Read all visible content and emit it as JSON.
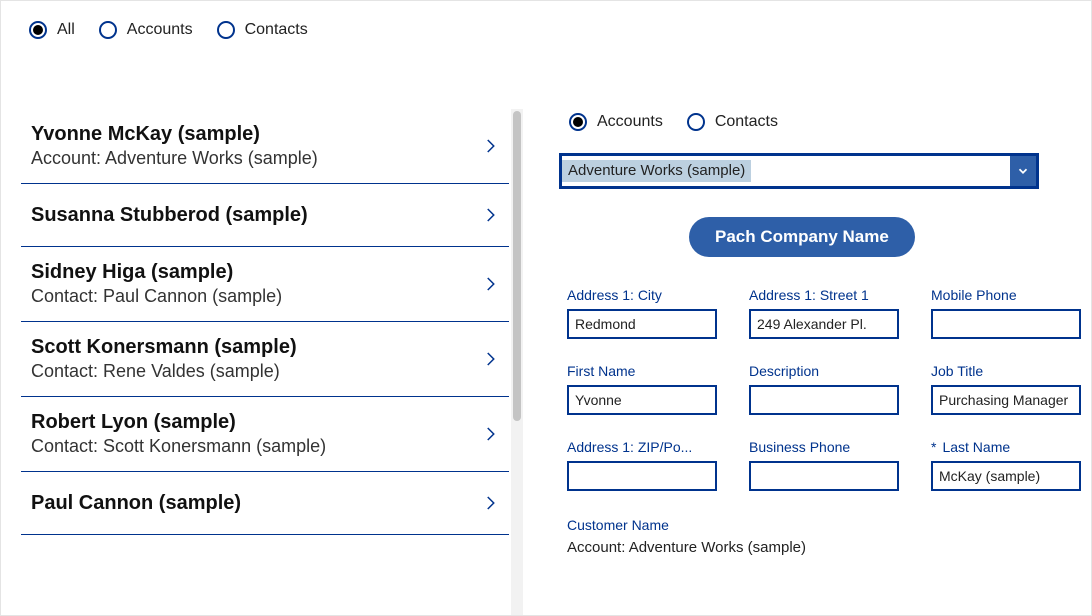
{
  "topFilters": [
    {
      "label": "All",
      "selected": true
    },
    {
      "label": "Accounts",
      "selected": false
    },
    {
      "label": "Contacts",
      "selected": false
    }
  ],
  "list": [
    {
      "title": "Yvonne McKay (sample)",
      "subtitle": "Account: Adventure Works (sample)"
    },
    {
      "title": "Susanna Stubberod (sample)",
      "subtitle": ""
    },
    {
      "title": "Sidney Higa (sample)",
      "subtitle": "Contact: Paul Cannon (sample)"
    },
    {
      "title": "Scott Konersmann (sample)",
      "subtitle": "Contact: Rene Valdes (sample)"
    },
    {
      "title": "Robert Lyon (sample)",
      "subtitle": "Contact: Scott Konersmann (sample)"
    },
    {
      "title": "Paul Cannon (sample)",
      "subtitle": ""
    }
  ],
  "detailFilters": [
    {
      "label": "Accounts",
      "selected": true
    },
    {
      "label": "Contacts",
      "selected": false
    }
  ],
  "accountSelect": "Adventure Works (sample)",
  "primaryButton": "Pach Company Name",
  "fields": [
    {
      "label": "Address 1: City",
      "value": "Redmond",
      "required": false
    },
    {
      "label": "Address 1: Street 1",
      "value": "249 Alexander Pl.",
      "required": false
    },
    {
      "label": "Mobile Phone",
      "value": "",
      "required": false
    },
    {
      "label": "First Name",
      "value": "Yvonne",
      "required": false
    },
    {
      "label": "Description",
      "value": "",
      "required": false
    },
    {
      "label": "Job Title",
      "value": "Purchasing Manager",
      "required": false
    },
    {
      "label": "Address 1: ZIP/Po...",
      "value": "",
      "required": false
    },
    {
      "label": "Business Phone",
      "value": "",
      "required": false
    },
    {
      "label": "Last Name",
      "value": "McKay (sample)",
      "required": true
    }
  ],
  "customer": {
    "label": "Customer Name",
    "value": "Account: Adventure Works (sample)"
  }
}
